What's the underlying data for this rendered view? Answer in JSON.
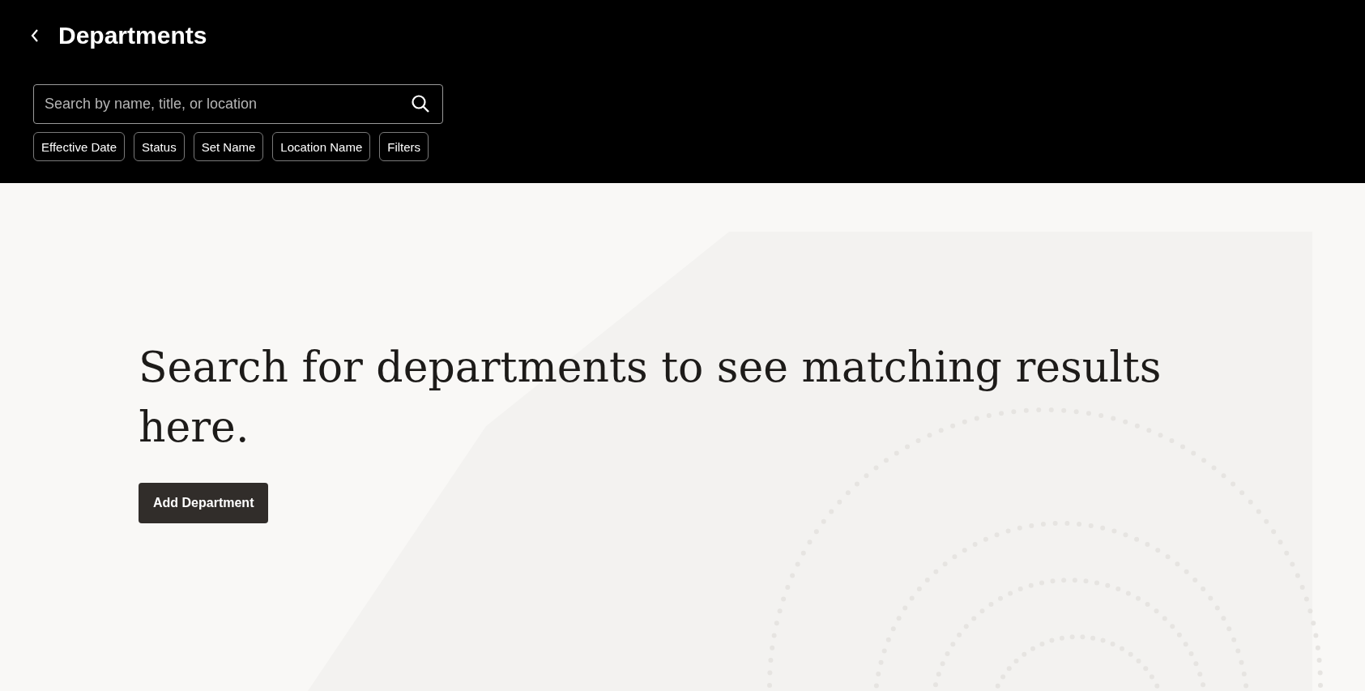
{
  "header": {
    "title": "Departments",
    "search": {
      "placeholder": "Search by name, title, or location"
    },
    "filters": [
      {
        "label": "Effective Date"
      },
      {
        "label": "Status"
      },
      {
        "label": "Set Name"
      },
      {
        "label": "Location Name"
      },
      {
        "label": "Filters"
      }
    ]
  },
  "empty_state": {
    "message": "Search for departments to see matching results here.",
    "button": "Add Department"
  }
}
